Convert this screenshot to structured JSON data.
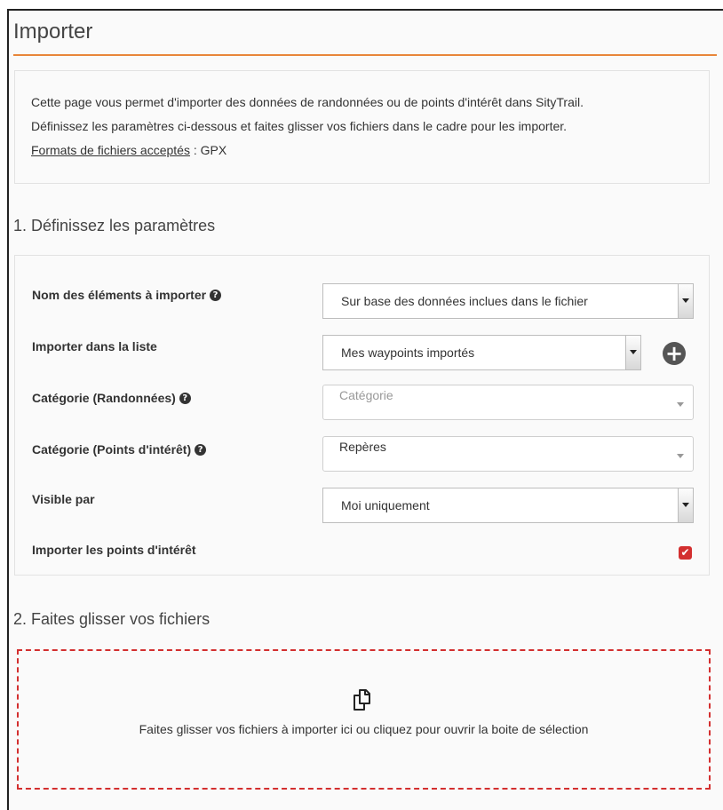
{
  "page": {
    "title": "Importer"
  },
  "info": {
    "line1": "Cette page vous permet d'importer des données de randonnées ou de points d'intérêt dans SityTrail.",
    "line2": "Définissez les paramètres ci-dessous et faites glisser vos fichiers dans le cadre pour les importer.",
    "formats_link": "Formats de fichiers acceptés",
    "formats_value": " : GPX"
  },
  "section1": {
    "title": "1. Définissez les paramètres",
    "rows": [
      {
        "label": "Nom des éléments à importer",
        "value": "Sur base des données inclues dans le fichier",
        "help": true
      },
      {
        "label": "Importer dans la liste",
        "value": "Mes waypoints importés",
        "help": false
      },
      {
        "label": "Catégorie (Randonnées)",
        "placeholder": "Catégorie",
        "help": true
      },
      {
        "label": "Catégorie (Points d'intérêt)",
        "value": "Repères",
        "help": true
      },
      {
        "label": "Visible par",
        "value": "Moi uniquement",
        "help": false
      },
      {
        "label": "Importer les points d'intérêt",
        "checked": true,
        "help": false
      }
    ],
    "help_glyph": "?",
    "plus_glyph": "+",
    "check_glyph": "✔"
  },
  "section2": {
    "title": "2. Faites glisser vos fichiers",
    "dropzone_text": "Faites glisser vos fichiers à importer ici ou cliquez pour ouvrir la boite de sélection"
  },
  "colors": {
    "accent": "#e8863a",
    "dropzone_border": "#d32f2f",
    "checkbox": "#d32f2f"
  }
}
